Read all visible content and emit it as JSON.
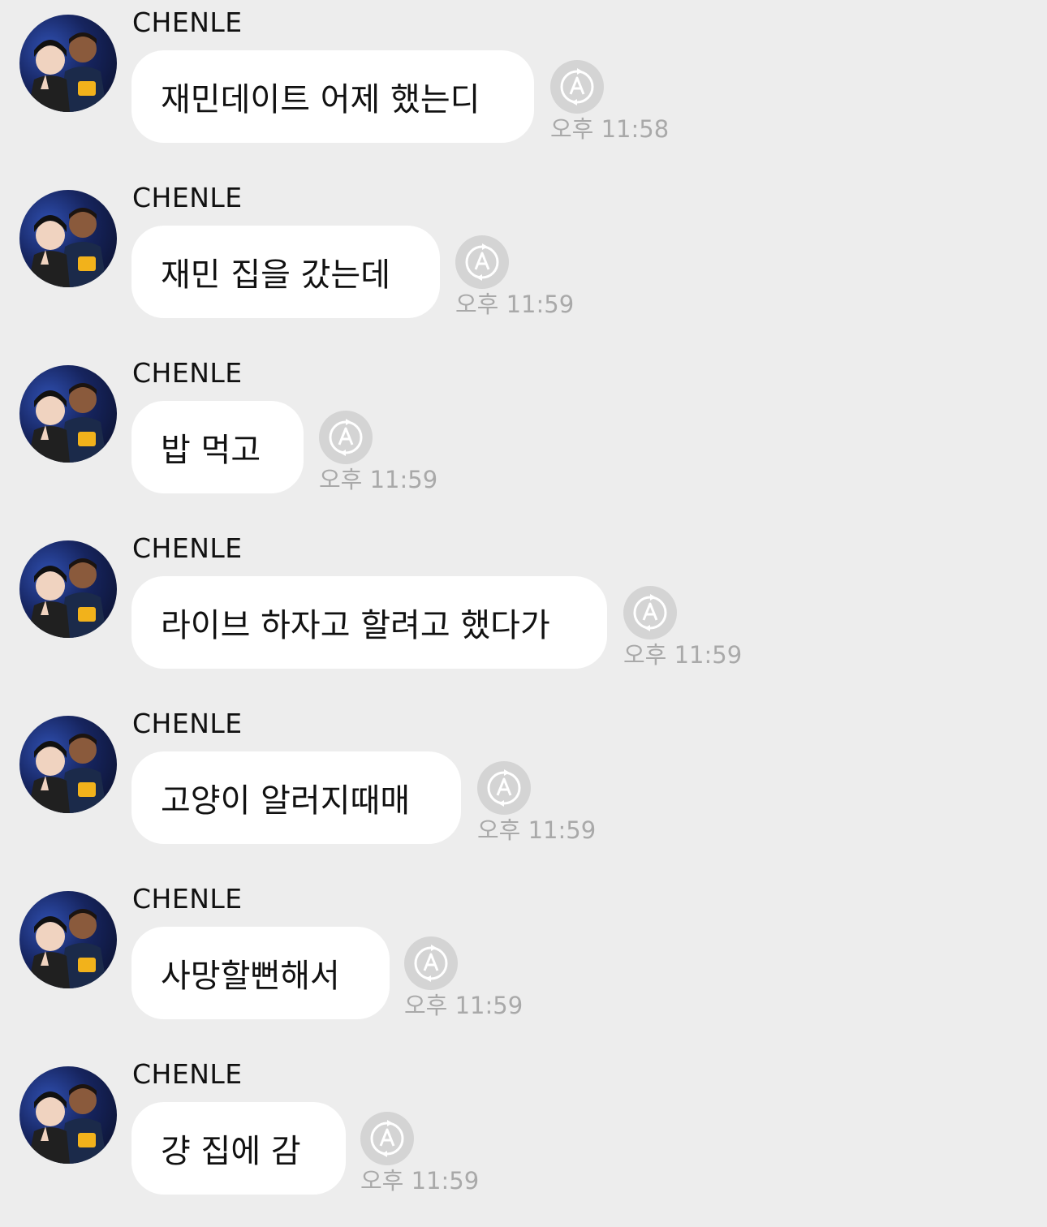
{
  "messages": [
    {
      "sender": "CHENLE",
      "text": "재민데이트 어제 했는디",
      "time": "오후 11:58"
    },
    {
      "sender": "CHENLE",
      "text": "재민 집을 갔는데",
      "time": "오후 11:59"
    },
    {
      "sender": "CHENLE",
      "text": "밥 먹고",
      "time": "오후 11:59"
    },
    {
      "sender": "CHENLE",
      "text": "라이브 하자고 할려고 했다가",
      "time": "오후 11:59"
    },
    {
      "sender": "CHENLE",
      "text": "고양이 알러지때매",
      "time": "오후 11:59"
    },
    {
      "sender": "CHENLE",
      "text": "사망할뻔해서",
      "time": "오후 11:59"
    },
    {
      "sender": "CHENLE",
      "text": "걍 집에 감",
      "time": "오후 11:59"
    }
  ],
  "icons": {
    "avatar": "profile-photo",
    "translate": "translate-icon"
  }
}
